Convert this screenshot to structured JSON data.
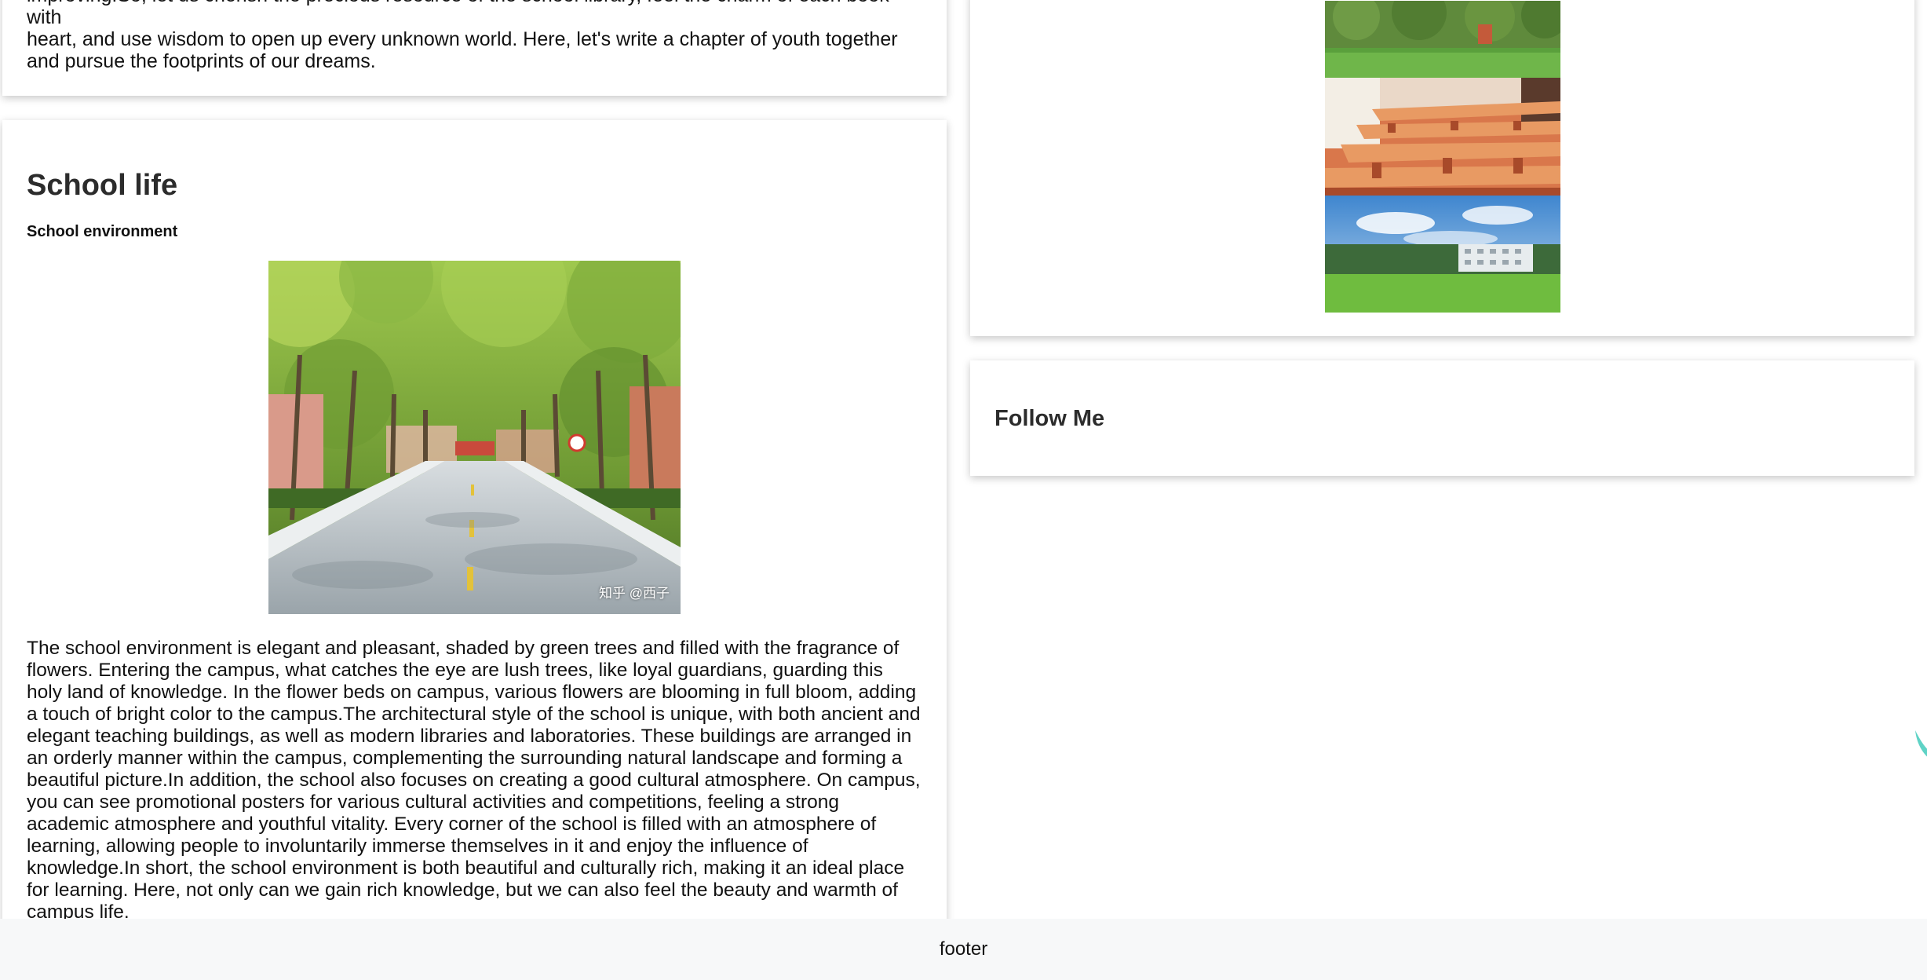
{
  "intro_card": {
    "text_partial": "improving.So, let us cherish the precious resource of the school library, feel the charm of each book with",
    "text_rest": "heart, and use wisdom to open up every unknown world. Here, let's write a chapter of youth together and pursue the footprints of our dreams."
  },
  "school_life": {
    "title": "School life",
    "subtitle": "School environment",
    "photo_caption": "知乎 @西子",
    "body": "The school environment is elegant and pleasant, shaded by green trees and filled with the fragrance of flowers. Entering the campus, what catches the eye are lush trees, like loyal guardians, guarding this holy land of knowledge. In the flower beds on campus, various flowers are blooming in full bloom, adding a touch of bright color to the campus.The architectural style of the school is unique, with both ancient and elegant teaching buildings, as well as modern libraries and laboratories. These buildings are arranged in an orderly manner within the campus, complementing the surrounding natural landscape and forming a beautiful picture.In addition, the school also focuses on creating a good cultural atmosphere. On campus, you can see promotional posters for various cultural activities and competitions, feeling a strong academic atmosphere and youthful vitality. Every corner of the school is filled with an atmosphere of learning, allowing people to involuntarily immerse themselves in it and enjoy the influence of knowledge.In short, the school environment is both beautiful and culturally rich, making it an ideal place for learning. Here, not only can we gain rich knowledge, but we can also feel the beauty and warmth of campus life."
  },
  "gallery": {
    "images": [
      "campus-lawn-photo",
      "classroom-photo",
      "campus-field-photo"
    ]
  },
  "follow": {
    "title": "Follow Me"
  },
  "footer": {
    "text": "footer"
  },
  "colors": {
    "card_bg": "#ffffff",
    "footer_bg": "#f7f8f9",
    "heading": "#2c2c2c",
    "deco_accent": "#5fd3c6"
  }
}
